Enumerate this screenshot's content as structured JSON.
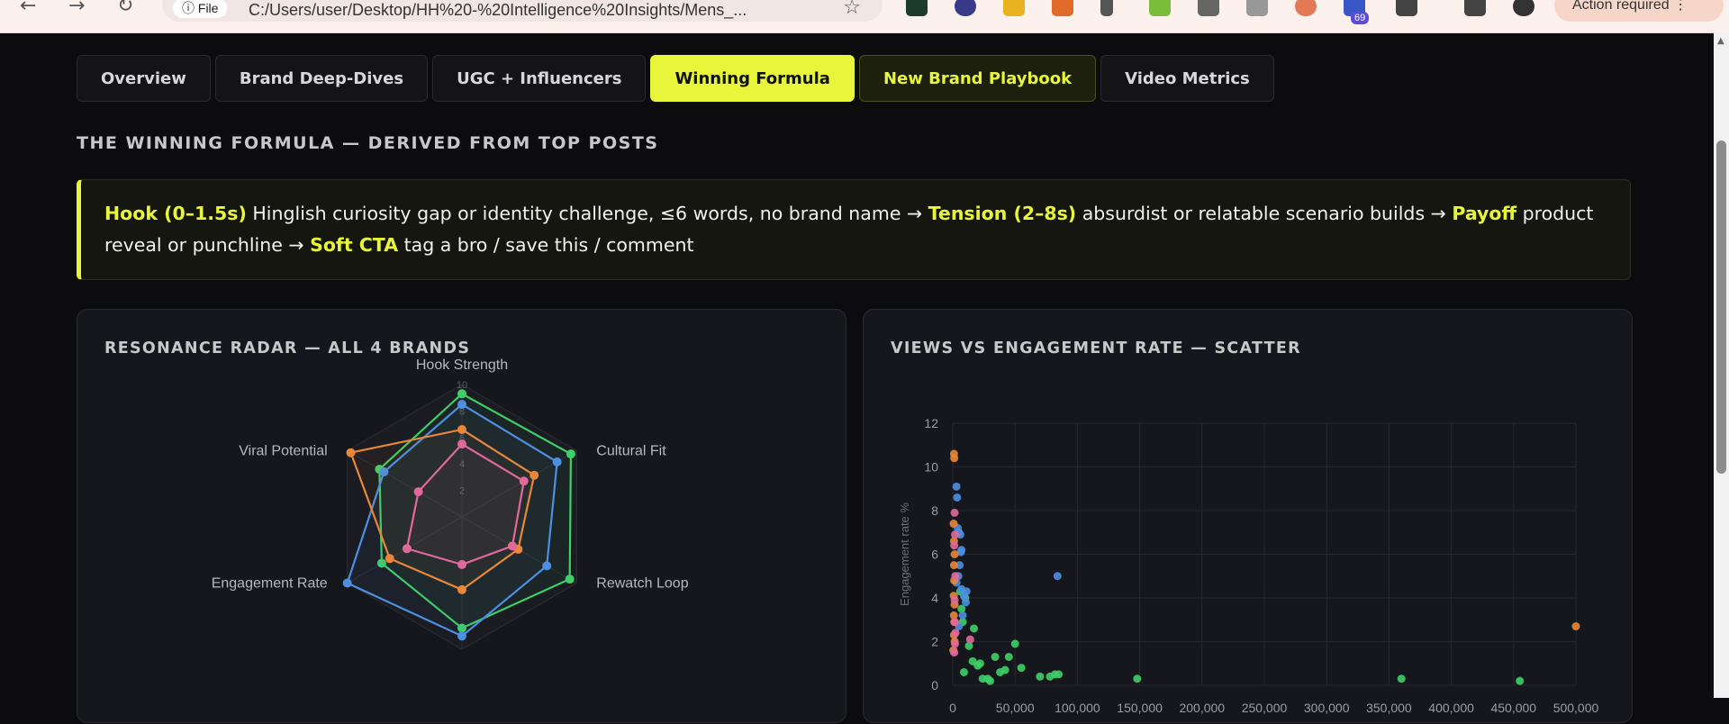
{
  "browser": {
    "info_label": "File",
    "url": "C:/Users/user/Desktop/HH%20-%20Intelligence%20Insights/Mens_...",
    "extension_badge": "69",
    "action_required": "Action required"
  },
  "tabs": [
    {
      "label": "Overview",
      "state": "default"
    },
    {
      "label": "Brand Deep-Dives",
      "state": "default"
    },
    {
      "label": "UGC + Influencers",
      "state": "default"
    },
    {
      "label": "Winning Formula",
      "state": "active"
    },
    {
      "label": "New Brand Playbook",
      "state": "highlight"
    },
    {
      "label": "Video Metrics",
      "state": "default"
    }
  ],
  "section_title": "THE WINNING FORMULA — DERIVED FROM TOP POSTS",
  "formula": {
    "hook_label": "Hook (0–1.5s)",
    "hook_text": " Hinglish curiosity gap or identity challenge, ≤6 words, no brand name → ",
    "tension_label": "Tension (2–8s)",
    "tension_text": " absurdist or relatable scenario builds → ",
    "payoff_label": "Payoff",
    "payoff_text": " product reveal or punchline → ",
    "cta_label": "Soft CTA",
    "cta_text": " tag a bro / save this / comment"
  },
  "colors": {
    "accent": "#e7f53b",
    "series_green": "#3ecf68",
    "series_blue": "#4d8fe0",
    "series_orange": "#e8873a",
    "series_pink": "#e0699c"
  },
  "chart_data": [
    {
      "type": "radar",
      "title": "RESONANCE RADAR — ALL 4 BRANDS",
      "axes": [
        "Hook Strength",
        "Cultural Fit",
        "Rewatch Loop",
        "Engagement Rate",
        "Viral Potential"
      ],
      "r_ticks": [
        "2",
        "4",
        "6",
        "8",
        "10"
      ],
      "r_range": [
        0,
        10
      ],
      "legend": "none",
      "series": [
        {
          "color": "#3ecf68",
          "values": [
            9.3,
            9.5,
            9.4,
            8.4,
            7.0,
            7.2
          ]
        },
        {
          "color": "#4d8fe0",
          "values": [
            8.5,
            8.3,
            7.4,
            9.0,
            10.0,
            6.8
          ]
        },
        {
          "color": "#e8873a",
          "values": [
            6.6,
            6.3,
            4.9,
            5.5,
            6.3,
            9.7
          ]
        },
        {
          "color": "#e0699c",
          "values": [
            5.5,
            5.4,
            4.4,
            3.6,
            4.8,
            3.8
          ]
        }
      ]
    },
    {
      "type": "scatter",
      "title": "VIEWS VS ENGAGEMENT RATE — SCATTER",
      "xlabel": "",
      "ylabel": "Engagement rate %",
      "xlim": [
        0,
        500000
      ],
      "ylim": [
        0,
        12
      ],
      "x_ticks": [
        "0",
        "50,000",
        "100,000",
        "150,000",
        "200,000",
        "250,000",
        "300,000",
        "350,000",
        "400,000",
        "450,000",
        "500,000"
      ],
      "y_ticks": [
        "0",
        "2",
        "4",
        "6",
        "8",
        "10",
        "12"
      ],
      "grid": true,
      "series": [
        {
          "color": "#3ecf68",
          "points": [
            [
              6000,
              4.3
            ],
            [
              7000,
              3.5
            ],
            [
              10000,
              4.0
            ],
            [
              8000,
              2.9
            ],
            [
              17000,
              2.6
            ],
            [
              13000,
              1.8
            ],
            [
              16000,
              1.1
            ],
            [
              20000,
              0.9
            ],
            [
              22000,
              1.0
            ],
            [
              24000,
              0.3
            ],
            [
              28000,
              0.3
            ],
            [
              30000,
              0.2
            ],
            [
              34000,
              1.3
            ],
            [
              38000,
              0.6
            ],
            [
              42000,
              0.7
            ],
            [
              45000,
              1.3
            ],
            [
              50000,
              1.9
            ],
            [
              55000,
              0.8
            ],
            [
              70000,
              0.4
            ],
            [
              78000,
              0.4
            ],
            [
              82000,
              0.5
            ],
            [
              85000,
              0.5
            ],
            [
              148000,
              0.3
            ],
            [
              360000,
              0.3
            ],
            [
              455000,
              0.2
            ],
            [
              9000,
              0.6
            ]
          ]
        },
        {
          "color": "#4d8fe0",
          "points": [
            [
              3000,
              9.1
            ],
            [
              3500,
              8.6
            ],
            [
              4000,
              7.2
            ],
            [
              5000,
              7.0
            ],
            [
              6000,
              6.9
            ],
            [
              7000,
              6.2
            ],
            [
              5500,
              5.5
            ],
            [
              4500,
              5.0
            ],
            [
              3000,
              4.7
            ],
            [
              7000,
              4.4
            ],
            [
              9000,
              4.1
            ],
            [
              10500,
              3.8
            ],
            [
              11000,
              4.3
            ],
            [
              8000,
              3.2
            ],
            [
              5000,
              2.7
            ],
            [
              84000,
              5.0
            ],
            [
              6500,
              6.1
            ]
          ]
        },
        {
          "color": "#e8873a",
          "points": [
            [
              1000,
              10.6
            ],
            [
              1200,
              10.4
            ],
            [
              700,
              7.4
            ],
            [
              1000,
              6.6
            ],
            [
              1500,
              6.0
            ],
            [
              1000,
              5.5
            ],
            [
              1200,
              4.8
            ],
            [
              800,
              4.1
            ],
            [
              1500,
              3.7
            ],
            [
              900,
              3.2
            ],
            [
              1300,
              2.9
            ],
            [
              1000,
              2.3
            ],
            [
              1500,
              2.0
            ],
            [
              500,
              1.6
            ],
            [
              500000,
              2.7
            ]
          ]
        },
        {
          "color": "#e0699c",
          "points": [
            [
              1500,
              7.9
            ],
            [
              1800,
              6.9
            ],
            [
              1200,
              6.4
            ],
            [
              2000,
              5.0
            ],
            [
              1500,
              3.9
            ],
            [
              1700,
              2.9
            ],
            [
              2200,
              2.4
            ],
            [
              1800,
              1.9
            ],
            [
              1200,
              1.5
            ],
            [
              14000,
              2.1
            ]
          ]
        }
      ]
    }
  ]
}
